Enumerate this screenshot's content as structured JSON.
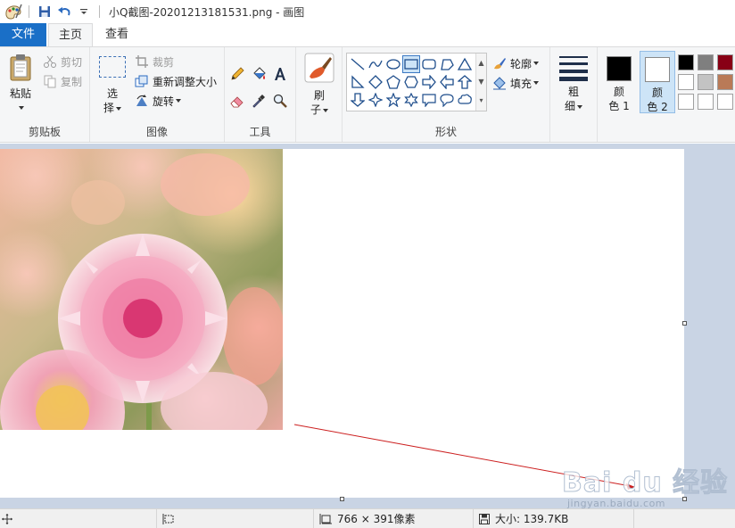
{
  "window": {
    "title": "小Q截图-20201213181531.png - 画图"
  },
  "tabs": {
    "file": "文件",
    "home": "主页",
    "view": "查看"
  },
  "clipboard": {
    "paste": "粘贴",
    "cut": "剪切",
    "copy": "复制",
    "label": "剪贴板"
  },
  "image": {
    "select_1": "选",
    "select_2": "择",
    "crop": "裁剪",
    "resize": "重新调整大小",
    "rotate": "旋转",
    "label": "图像"
  },
  "tools": {
    "label": "工具"
  },
  "brushes": {
    "label_1": "刷",
    "label_2": "子"
  },
  "shapes": {
    "outline": "轮廓",
    "fill": "填充",
    "label": "形状"
  },
  "size": {
    "label_1": "粗",
    "label_2": "细"
  },
  "colors": {
    "color1_1": "颜",
    "color1_2": "色 1",
    "color2_1": "颜",
    "color2_2": "色 2",
    "color1": "#000000",
    "color2": "#ffffff",
    "palette": [
      "#000000",
      "#7f7f7f",
      "#880015",
      "#ffffff",
      "#c3c3c3",
      "#b97a57",
      "#ffffff",
      "#ffffff",
      "#ffffff"
    ]
  },
  "watermark": {
    "main": "Bai du 经验",
    "sub": "jingyan.baidu.com"
  },
  "status": {
    "dimensions": "766 × 391像素",
    "size": "大小: 139.7KB"
  }
}
